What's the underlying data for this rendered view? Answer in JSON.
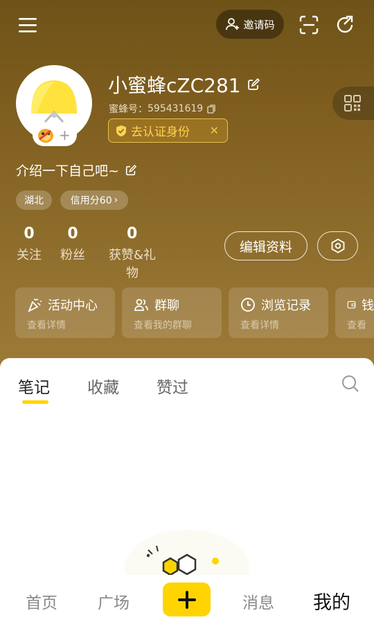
{
  "topbar": {
    "invite_label": "邀请码",
    "icons": [
      "menu-icon",
      "invite-user-icon",
      "scan-icon",
      "share-icon"
    ]
  },
  "profile": {
    "username": "小蜜蜂cZC281",
    "bee_id_label": "蜜蜂号：",
    "bee_id": "595431619",
    "verify_label": "去认证身份",
    "intro": "介绍一下自己吧~",
    "tags": {
      "location": "湖北",
      "credit": "信用分60"
    }
  },
  "stats": [
    {
      "value": "0",
      "label": "关注"
    },
    {
      "value": "0",
      "label": "粉丝"
    },
    {
      "value": "0",
      "label": "获赞&礼物"
    }
  ],
  "actions": {
    "edit_label": "编辑资料"
  },
  "cards": [
    {
      "title": "活动中心",
      "sub": "查看详情",
      "icon": "party-icon"
    },
    {
      "title": "群聊",
      "sub": "查看我的群聊",
      "icon": "group-icon"
    },
    {
      "title": "浏览记录",
      "sub": "查看详情",
      "icon": "clock-icon"
    },
    {
      "title": "钱",
      "sub": "查看",
      "icon": "wallet-icon"
    }
  ],
  "tabs": [
    "笔记",
    "收藏",
    "赞过"
  ],
  "active_tab": "笔记",
  "bottom_nav": [
    "首页",
    "广场",
    "消息",
    "我的"
  ],
  "active_nav": "我的",
  "colors": {
    "accent": "#ffd400",
    "header_bg": "#8b6a29",
    "verify_text": "#ffd34f"
  }
}
